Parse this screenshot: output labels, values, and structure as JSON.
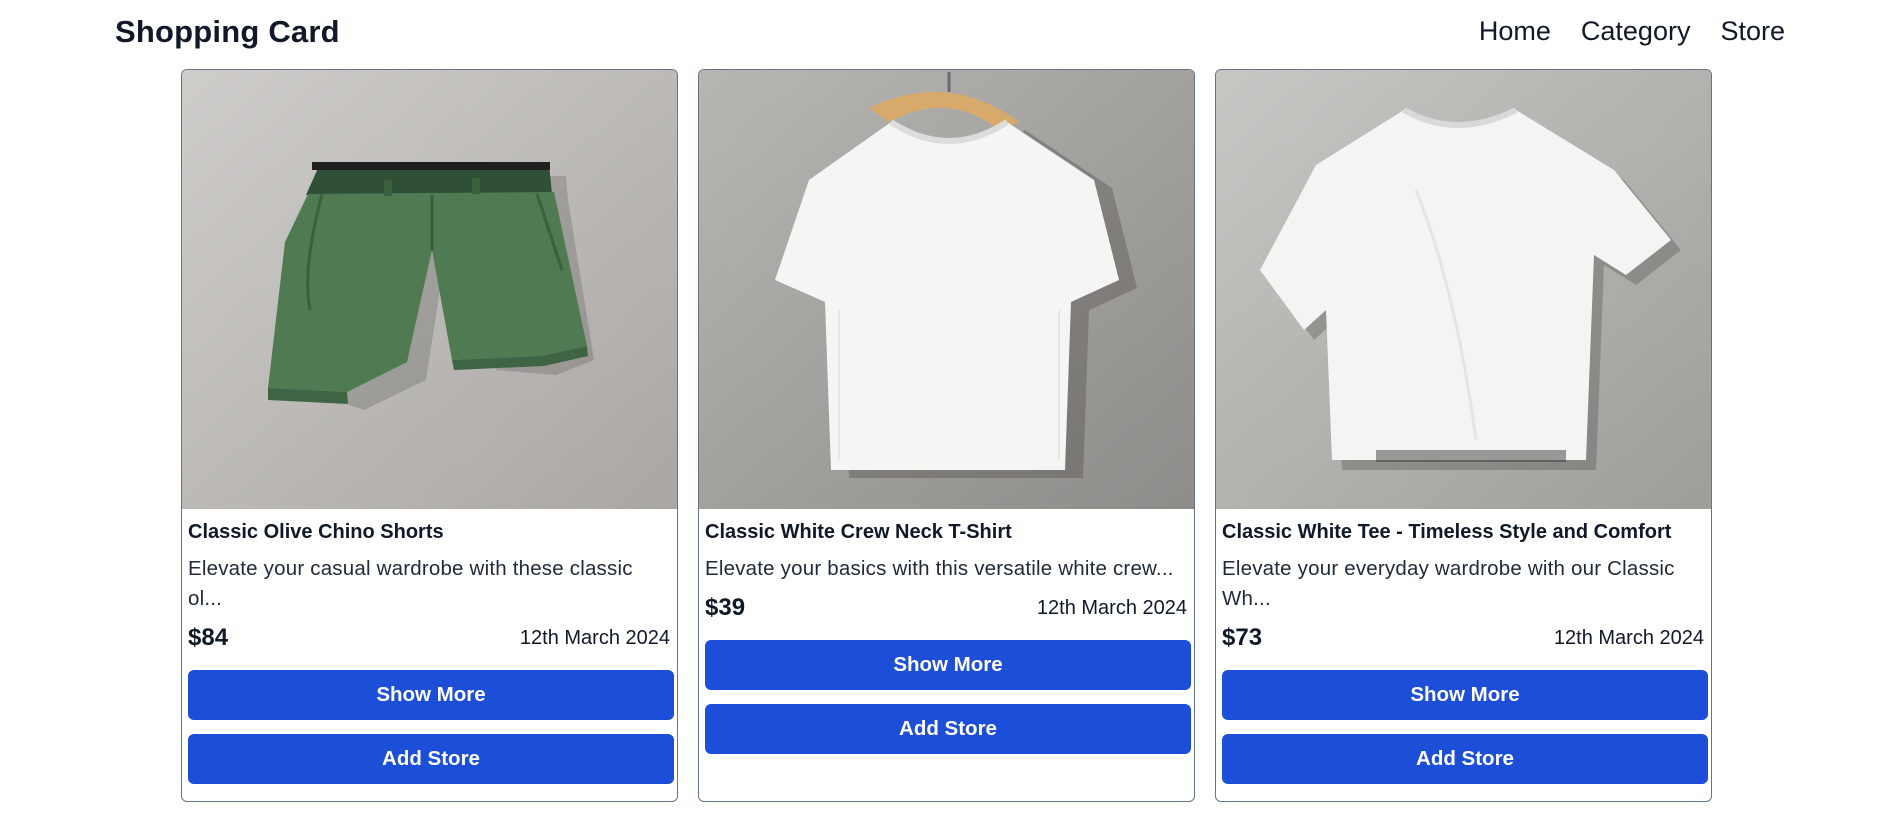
{
  "header": {
    "brand": "Shopping Card",
    "nav": [
      "Home",
      "Category",
      "Store"
    ]
  },
  "cards": [
    {
      "title": "Classic Olive Chino Shorts",
      "description": "Elevate your casual wardrobe with these classic ol...",
      "price": "$84",
      "date": "12th March 2024",
      "show_more": "Show More",
      "add_store": "Add Store",
      "image": "olive-chino-shorts-photo"
    },
    {
      "title": "Classic White Crew Neck T-Shirt",
      "description": "Elevate your basics with this versatile white crew...",
      "price": "$39",
      "date": "12th March 2024",
      "show_more": "Show More",
      "add_store": "Add Store",
      "image": "white-tshirt-on-hanger-photo"
    },
    {
      "title": "Classic White Tee - Timeless Style and Comfort",
      "description": "Elevate your everyday wardrobe with our Classic Wh...",
      "price": "$73",
      "date": "12th March 2024",
      "show_more": "Show More",
      "add_store": "Add Store",
      "image": "white-tshirt-flat-photo"
    }
  ],
  "colors": {
    "button": "#1d4ed8",
    "card_border": "#64748b",
    "text": "#111827"
  }
}
